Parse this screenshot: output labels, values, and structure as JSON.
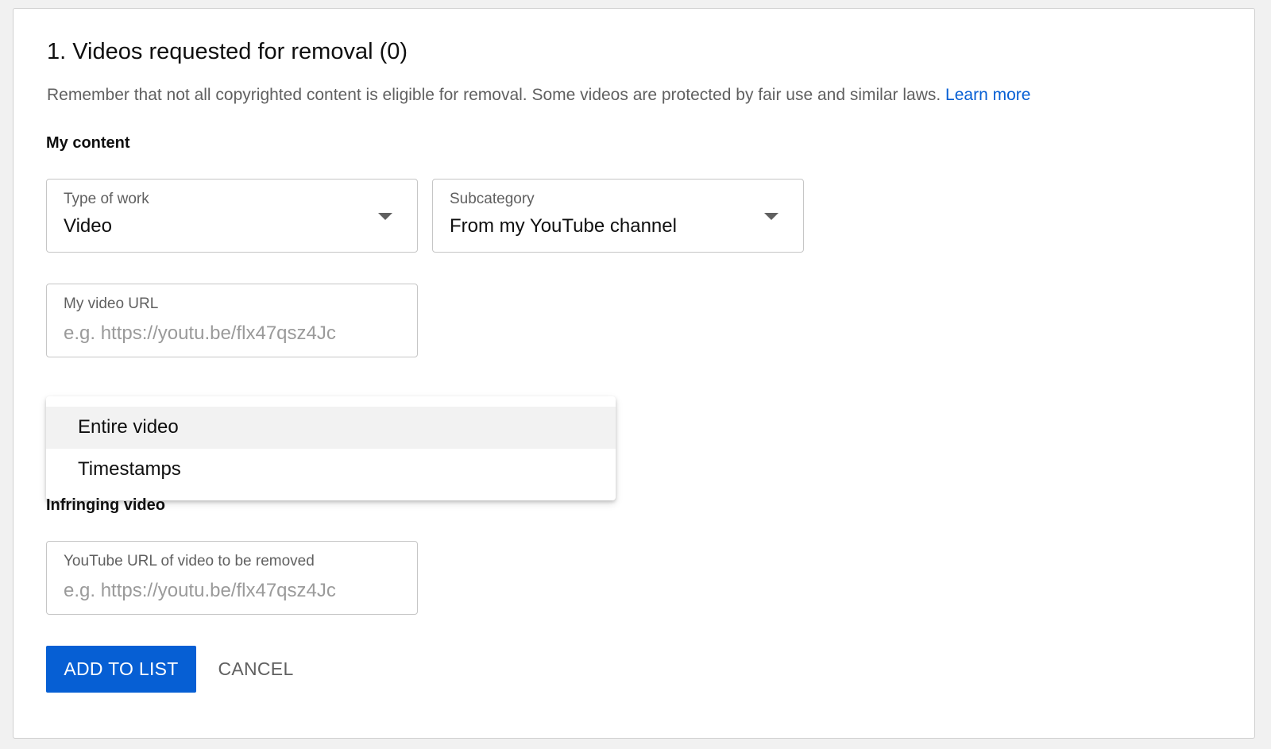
{
  "section": {
    "title": "1. Videos requested for removal (0)",
    "notice": "Remember that not all copyrighted content is eligible for removal. Some videos are protected by fair use and similar laws.",
    "learn_more": "Learn more"
  },
  "my_content": {
    "label": "My content",
    "type_of_work": {
      "label": "Type of work",
      "value": "Video",
      "icon": "caret-down-icon"
    },
    "subcategory": {
      "label": "Subcategory",
      "value": "From my YouTube channel",
      "icon": "caret-down-icon"
    },
    "video_url": {
      "label": "My video URL",
      "placeholder": "e.g. https://youtu.be/flx47qsz4Jc",
      "value": ""
    }
  },
  "dropdown_menu": {
    "items": [
      {
        "label": "Entire video",
        "selected": true
      },
      {
        "label": "Timestamps",
        "selected": false
      }
    ]
  },
  "infringing": {
    "label": "Infringing video",
    "url": {
      "label": "YouTube URL of video to be removed",
      "placeholder": "e.g. https://youtu.be/flx47qsz4Jc",
      "value": ""
    }
  },
  "actions": {
    "add_label": "ADD TO LIST",
    "cancel_label": "CANCEL"
  },
  "colors": {
    "accent": "#065fd4",
    "text_secondary": "#606060",
    "border": "#c6c6c6",
    "menu_highlight": "#f2f2f2"
  }
}
